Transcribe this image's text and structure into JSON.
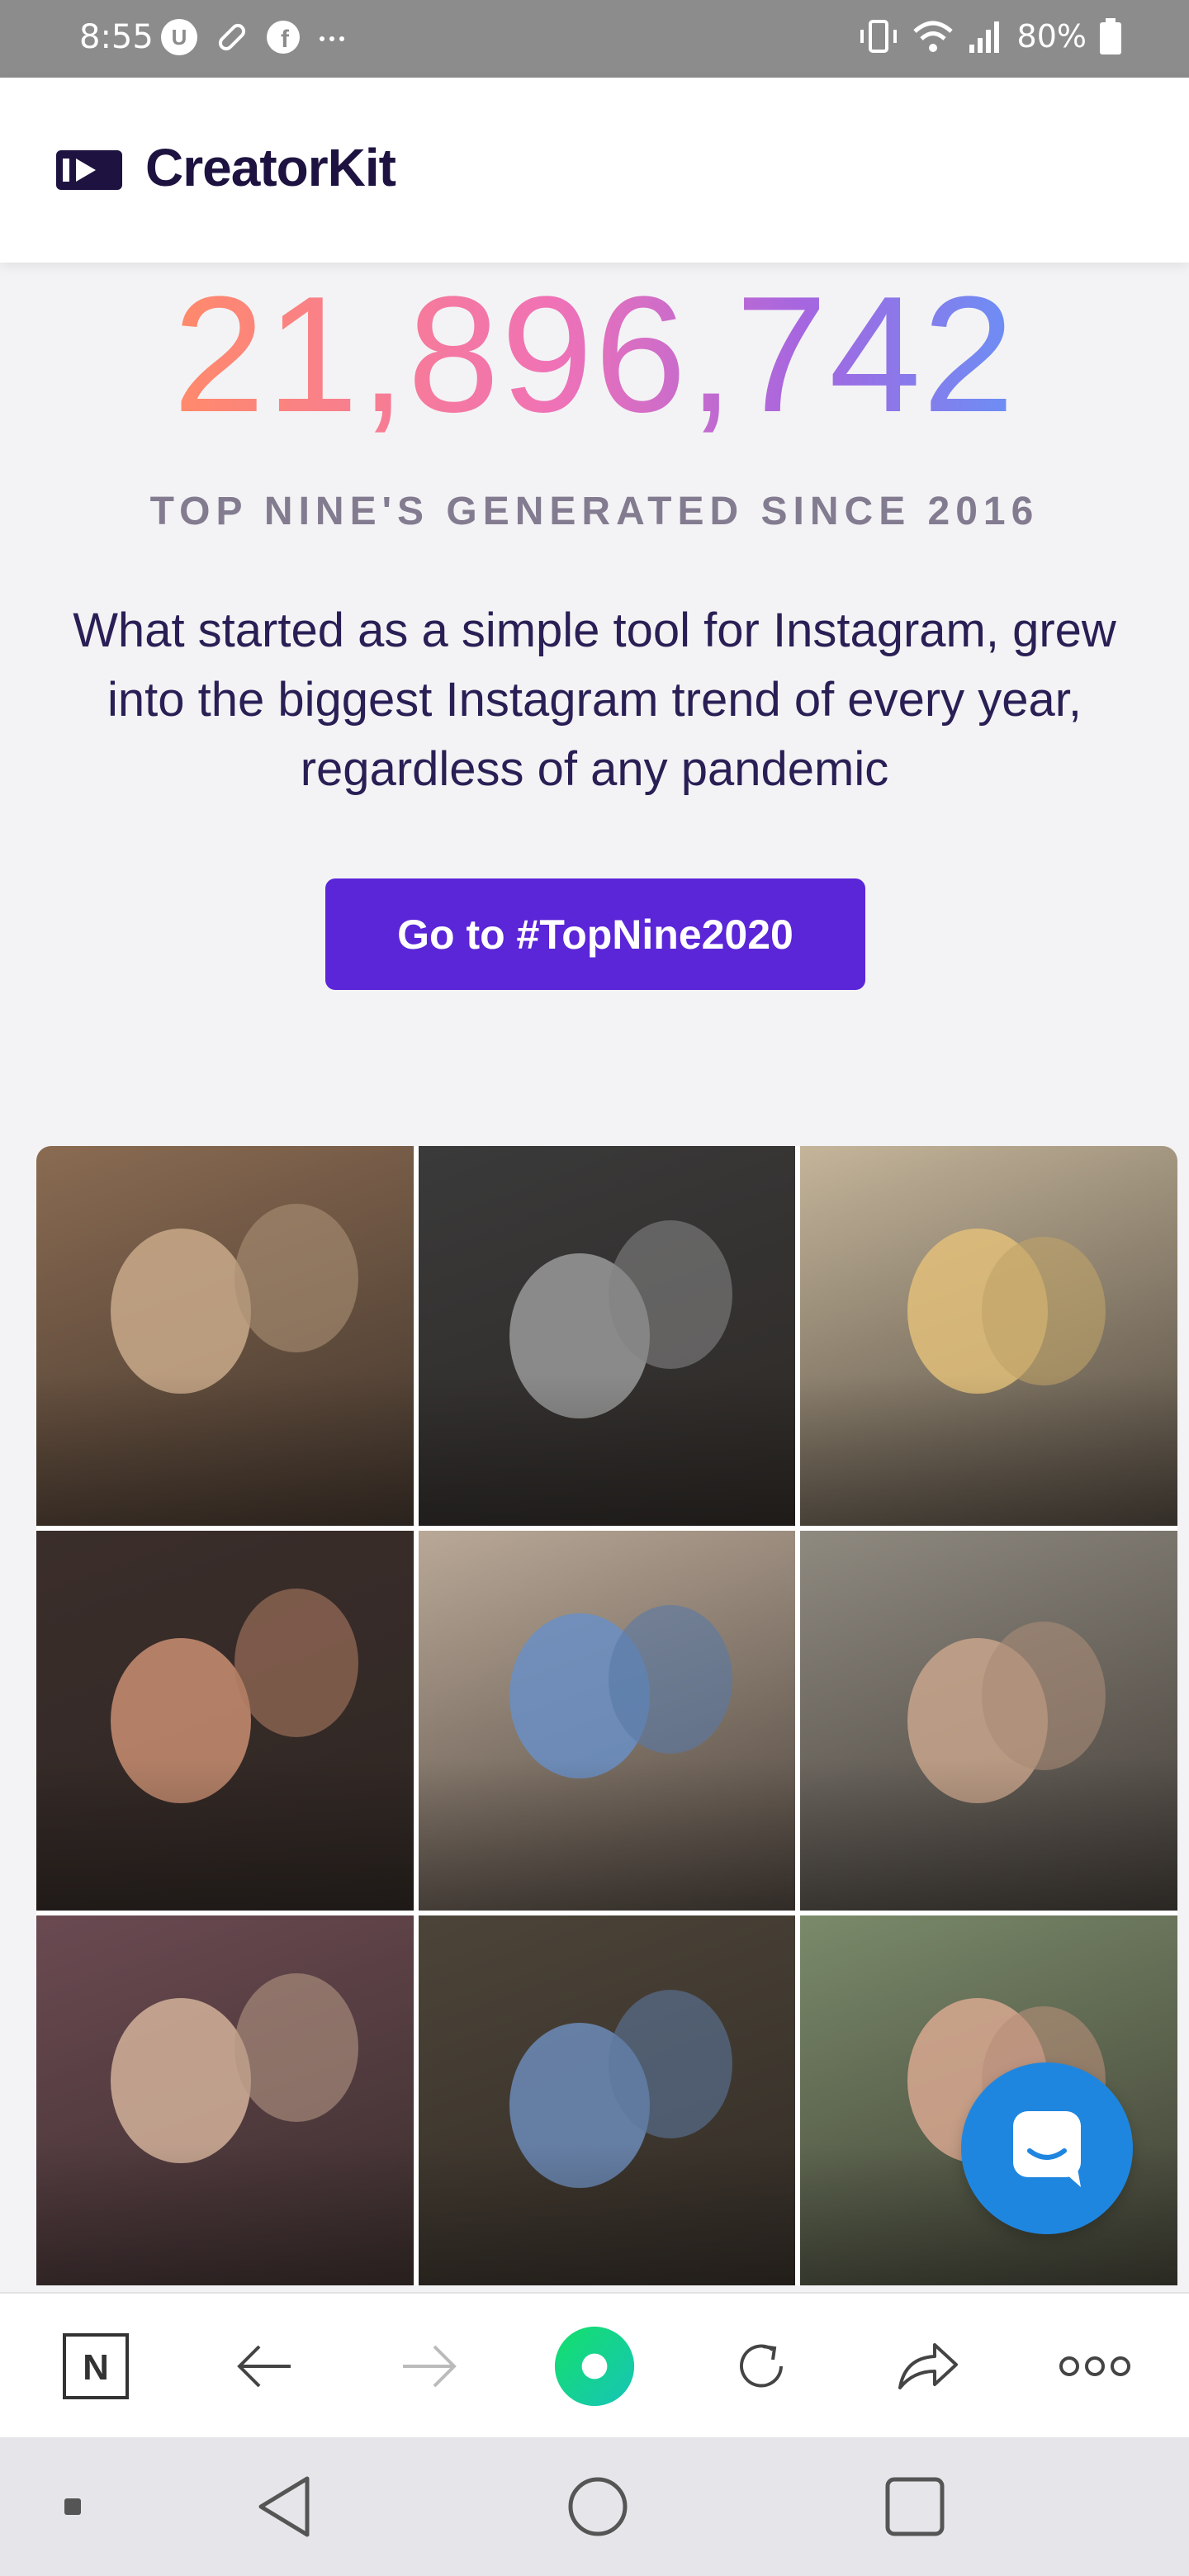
{
  "status_bar": {
    "time": "8:55",
    "battery": "80%",
    "left_icons": [
      "u-badge-icon",
      "pill-icon",
      "facebook-icon",
      "more-dots-icon"
    ],
    "right_icons": [
      "vibrate-icon",
      "wifi-icon",
      "signal-icon",
      "battery-icon"
    ]
  },
  "header": {
    "brand": "CreatorKit",
    "logo_icon": "creatorkit-logo-icon"
  },
  "main": {
    "counter": "21,896,742",
    "subtitle": "TOP NINE'S GENERATED SINCE 2016",
    "description": "What started as a simple tool for Instagram, grew into the biggest Instagram trend of every year, regardless of any pandemic",
    "cta_label": "Go to #TopNine2020"
  },
  "photo_grid": {
    "tiles": [
      {
        "bg": "#8a6b52",
        "accent": "#c9a98a"
      },
      {
        "bg": "#3a3a3a",
        "accent": "#9a9a9a"
      },
      {
        "bg": "#c4b59a",
        "accent": "#e2c07a"
      },
      {
        "bg": "#3b2e2b",
        "accent": "#c98e72"
      },
      {
        "bg": "#b9a897",
        "accent": "#6a8fc4"
      },
      {
        "bg": "#8f8a80",
        "accent": "#c8a58c"
      },
      {
        "bg": "#6b4a52",
        "accent": "#d2b19a"
      },
      {
        "bg": "#4c4438",
        "accent": "#6c8bb8"
      },
      {
        "bg": "#7a8a6a",
        "accent": "#d8a890"
      }
    ]
  },
  "chat": {
    "icon": "chat-bubble-icon",
    "color": "#1f86e0"
  },
  "browser_toolbar": {
    "icons": [
      "n-tab-icon",
      "back-arrow-icon",
      "forward-arrow-icon",
      "home-circle-icon",
      "refresh-icon",
      "share-icon",
      "more-icon"
    ]
  },
  "nav_bar": {
    "icons": [
      "small-square-icon",
      "nav-back-icon",
      "nav-home-icon",
      "nav-recents-icon"
    ]
  },
  "colors": {
    "brand_purple": "#5b25d8",
    "text_dark": "#2a1f55",
    "subtitle_gray": "#837b90"
  }
}
